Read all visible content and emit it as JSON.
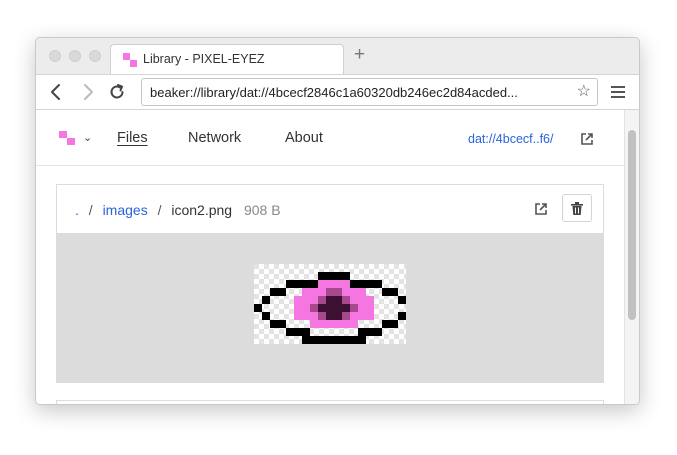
{
  "browser": {
    "tab_title": "Library - PIXEL-EYEZ",
    "new_tab_symbol": "+",
    "url": "beaker://library/dat://4bcecf2846c1a60320db246ec2d84acded...",
    "bookmark_symbol": "☆"
  },
  "site_nav": {
    "links": [
      "Files",
      "Network",
      "About"
    ],
    "active_link": "Files",
    "dat_link": "dat://4bcecf..f6/"
  },
  "file": {
    "root": ".",
    "folder": "images",
    "separator": "/",
    "name": "icon2.png",
    "size": "908 B"
  },
  "colors": {
    "brand_pink": "#f576e0",
    "link_blue": "#2864dc",
    "preview_bg": "#dcdcdc"
  },
  "icons": {
    "back": "back-arrow-icon",
    "forward": "forward-arrow-icon",
    "reload": "reload-icon",
    "menu": "hamburger-menu-icon",
    "open_external": "open-external-icon",
    "delete": "trash-icon"
  }
}
